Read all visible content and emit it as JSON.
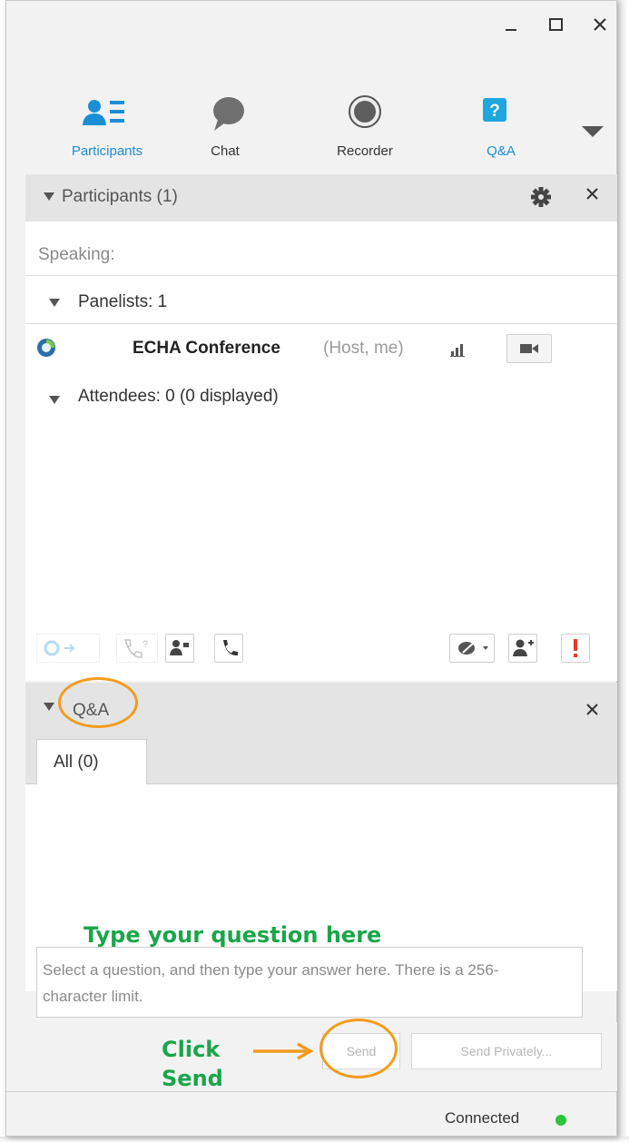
{
  "toolbar": {
    "items": [
      {
        "label": "Participants",
        "icon": "participants-icon",
        "active": true
      },
      {
        "label": "Chat",
        "icon": "chat-icon",
        "active": false
      },
      {
        "label": "Recorder",
        "icon": "recorder-icon",
        "active": false
      },
      {
        "label": "Q&A",
        "icon": "qa-icon",
        "active": true
      }
    ]
  },
  "participants_panel": {
    "title": "Participants (1)",
    "speaking_label": "Speaking:",
    "panelists_label": "Panelists: 1",
    "panelist": {
      "name": "ECHA Conference",
      "role": "(Host, me)"
    },
    "attendees_label": "Attendees: 0 (0 displayed)"
  },
  "qa_panel": {
    "title": "Q&A",
    "tab_all": "All (0)",
    "input_placeholder": "Select a question, and then type your answer here. There is a 256-character limit.",
    "send_label": "Send",
    "send_privately_label": "Send Privately..."
  },
  "status": {
    "text": "Connected",
    "color": "#2ec43a"
  },
  "annotations": {
    "type_question": "Type your question here",
    "click": "Click",
    "send": "Send"
  },
  "colors": {
    "accent": "#1a8fd6",
    "annotation_green": "#19a64a",
    "annotation_orange": "#f39c1e"
  }
}
